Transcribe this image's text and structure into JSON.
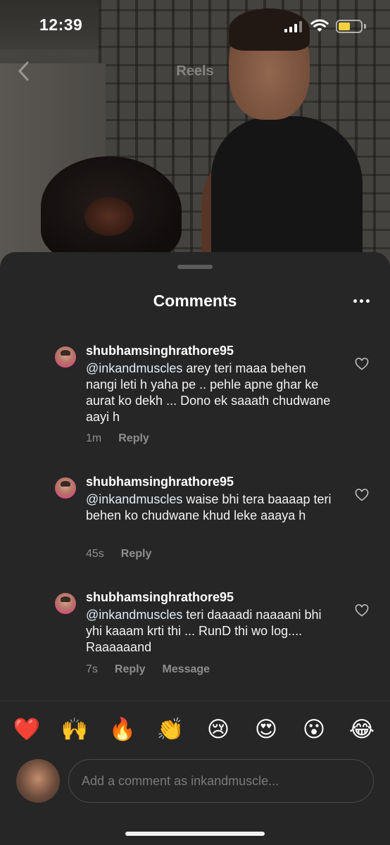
{
  "status_bar": {
    "time": "12:39"
  },
  "header": {
    "title": "Reels"
  },
  "sheet": {
    "title": "Comments"
  },
  "comments": [
    {
      "username": "shubhamsinghrathore95",
      "mention": "@inkandmuscles",
      "text": " arey teri maaa behen nangi leti h yaha pe .. pehle apne ghar ke aurat ko dekh ... Dono ek saaath chudwane aayi h",
      "time_ago": "1m",
      "reply_label": "Reply"
    },
    {
      "username": "shubhamsinghrathore95",
      "mention": "@inkandmuscles",
      "text": " waise bhi tera baaaap teri behen ko chudwane khud leke aaaya h",
      "time_ago": "45s",
      "reply_label": "Reply"
    },
    {
      "username": "shubhamsinghrathore95",
      "mention": "@inkandmuscles",
      "text": " teri daaaadi naaaani bhi yhi kaaam krti thi ... RunD thi wo log.... Raaaaaand",
      "time_ago": "7s",
      "reply_label": "Reply",
      "message_label": "Message"
    }
  ],
  "emoji_reactions": [
    "❤️",
    "🙌",
    "🔥",
    "👏",
    "😢",
    "😍",
    "😮",
    "😂"
  ],
  "composer": {
    "placeholder": "Add a comment as inkandmuscle..."
  },
  "colors": {
    "sheet_bg": "#262626",
    "mention": "#e1ecf9",
    "meta": "#8e8e8e",
    "battery": "#f5d23c"
  }
}
